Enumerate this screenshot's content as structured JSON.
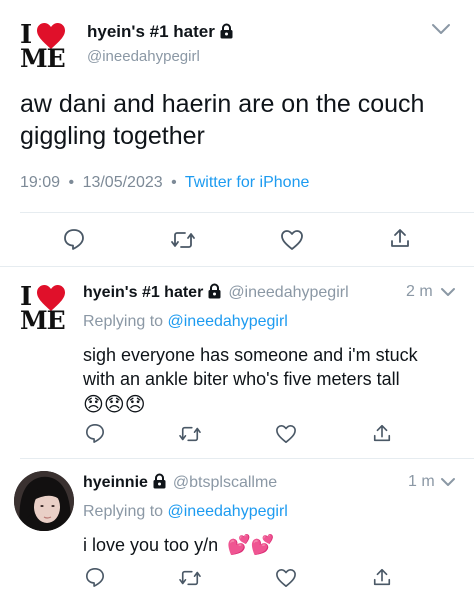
{
  "main_tweet": {
    "author_name": "hyein's #1 hater",
    "author_handle": "@ineedahypegirl",
    "text": "aw dani and haerin are on the couch giggling together",
    "time": "19:09",
    "date": "13/05/2023",
    "source": "Twitter for iPhone",
    "separator": "•"
  },
  "replies": [
    {
      "author_name": "hyein's #1 hater",
      "author_handle": "@ineedahypegirl",
      "time_ago": "2 m",
      "replying_to_label": "Replying to",
      "replying_to_handle": "@ineedahypegirl",
      "text_line1": "sigh everyone has someone and i'm stuck",
      "text_line2": "with an ankle biter who's five meters tall",
      "emoji": "😞😞😞"
    },
    {
      "author_name": "hyeinnie",
      "author_handle": "@btsplscallme",
      "time_ago": "1 m",
      "replying_to_label": "Replying to",
      "replying_to_handle": "@ineedahypegirl",
      "text": "i love you too y/n",
      "emoji": "💕💕"
    }
  ],
  "logo_text": {
    "top": "I",
    "bottom": "ME"
  },
  "colors": {
    "accent": "#1d9bf0",
    "muted": "#8b98a5",
    "heart": "#e0102a"
  },
  "icons": [
    "lock-icon",
    "chevron-down-icon",
    "reply-icon",
    "retweet-icon",
    "like-icon",
    "share-icon"
  ]
}
